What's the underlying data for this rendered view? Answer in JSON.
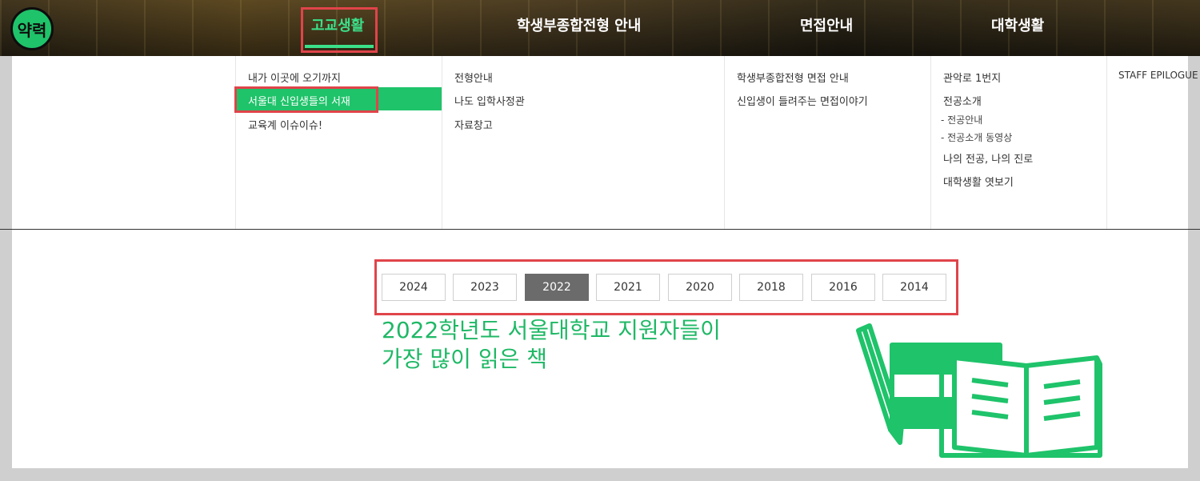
{
  "logo": {
    "label": "약력"
  },
  "nav": {
    "items": [
      "고교생활",
      "학생부종합전형 안내",
      "면접안내",
      "대학생활"
    ],
    "active_index": 0
  },
  "menu": {
    "col1": [
      "내가 이곳에 오기까지",
      "서울대 신입생들의 서재",
      "교육계 이슈이슈!"
    ],
    "col2": [
      "전형안내",
      "나도 입학사정관",
      "자료창고"
    ],
    "col3": [
      "학생부종합전형 면접 안내",
      "신입생이 들려주는 면접이야기"
    ],
    "col4": [
      "관악로 1번지",
      "전공소개",
      "-  전공안내",
      "-  전공소개 동영상",
      "나의 전공, 나의 진로",
      "대학생활 엿보기"
    ],
    "col5": [
      "STAFF EPILOGUE"
    ],
    "highlighted": "서울대 신입생들의 서재"
  },
  "years": {
    "options": [
      "2024",
      "2023",
      "2022",
      "2021",
      "2020",
      "2018",
      "2016",
      "2014"
    ],
    "selected": "2022"
  },
  "headline": {
    "line1": "2022학년도 서울대학교 지원자들이",
    "line2": "가장 많이 읽은 책"
  },
  "colors": {
    "accent": "#1fc36a",
    "headline": "#1fb866",
    "highlight_box": "#e0444a",
    "selected_year_bg": "#6b6b6b"
  },
  "icons": [
    "books-icon"
  ]
}
